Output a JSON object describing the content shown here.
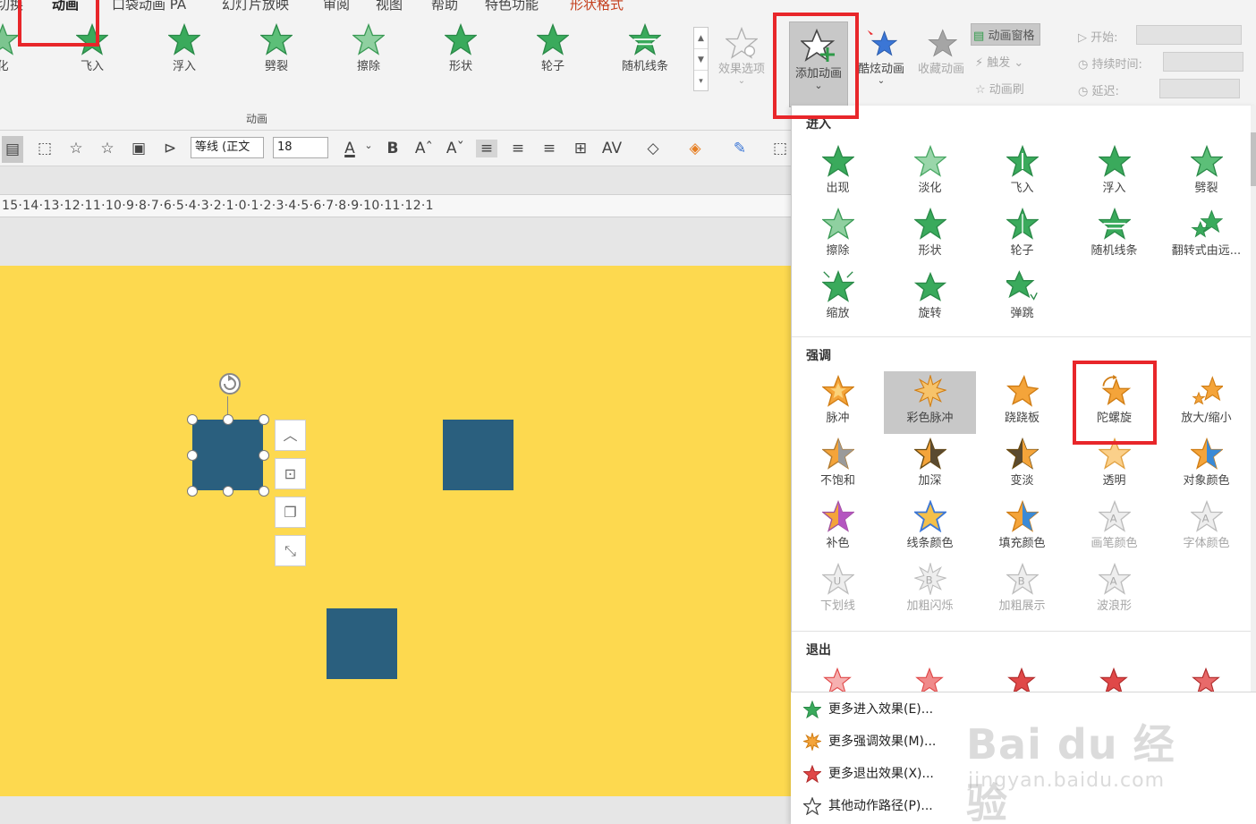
{
  "ribbon": {
    "tabs": [
      "切换",
      "动画",
      "口袋动画 PA",
      "幻灯片放映",
      "审阅",
      "视图",
      "帮助",
      "特色功能",
      "形状格式"
    ],
    "gallery": [
      "化",
      "飞入",
      "浮入",
      "劈裂",
      "擦除",
      "形状",
      "轮子",
      "随机线条"
    ],
    "effect_options": "效果选项",
    "add_animation": "添加动画",
    "fancy_animation": "酷炫动画",
    "collect_animation": "收藏动画",
    "animation_pane": "动画窗格",
    "trigger": "触发",
    "animation_brush": "动画刷",
    "start_label": "开始:",
    "duration_label": "持续时间:",
    "delay_label": "延迟:",
    "group_label": "动画"
  },
  "format_bar": {
    "font_name": "等线 (正文",
    "font_size": "18"
  },
  "ruler": "15·14·13·12·11·10·9·8·7·6·5·4·3·2·1·0·1·2·3·4·5·6·7·8·9·10·11·12·1",
  "dropdown": {
    "entrance": {
      "title": "进入",
      "items": [
        "出现",
        "淡化",
        "飞入",
        "浮入",
        "劈裂",
        "擦除",
        "形状",
        "轮子",
        "随机线条",
        "翻转式由远...",
        "缩放",
        "旋转",
        "弹跳"
      ]
    },
    "emphasis": {
      "title": "强调",
      "items": [
        "脉冲",
        "彩色脉冲",
        "跷跷板",
        "陀螺旋",
        "放大/缩小",
        "不饱和",
        "加深",
        "变淡",
        "透明",
        "对象颜色",
        "补色",
        "线条颜色",
        "填充颜色",
        "画笔颜色",
        "字体颜色",
        "下划线",
        "加粗闪烁",
        "加粗展示",
        "波浪形"
      ]
    },
    "exit": {
      "title": "退出"
    },
    "more": [
      "更多进入效果(E)...",
      "更多强调效果(M)...",
      "更多退出效果(X)...",
      "其他动作路径(P)..."
    ]
  },
  "watermark": {
    "logo": "Bai du 经验",
    "url": "jingyan.baidu.com"
  },
  "colors": {
    "slide_bg": "#fdd94f",
    "shape_fill": "#2a5f7e",
    "entrance_green": "#3aaa5c",
    "emphasis_orange": "#f4a43a",
    "exit_red": "#e04848",
    "highlight_red": "#e8262a"
  }
}
